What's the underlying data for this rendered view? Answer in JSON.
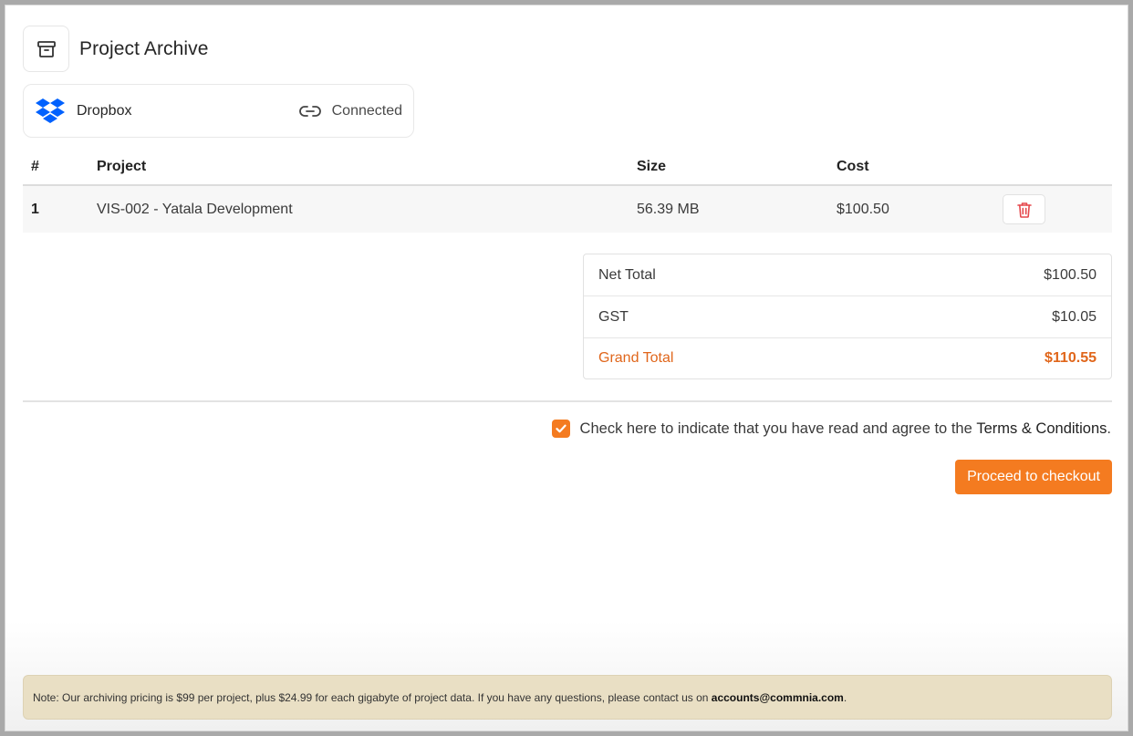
{
  "header": {
    "title": "Project Archive",
    "icon": "archive-box-icon"
  },
  "provider": {
    "name": "Dropbox",
    "status": "Connected",
    "icon": "dropbox-logo-icon",
    "status_icon": "link-icon"
  },
  "table": {
    "headers": {
      "num": "#",
      "project": "Project",
      "size": "Size",
      "cost": "Cost"
    },
    "rows": [
      {
        "num": "1",
        "project": "VIS-002 - Yatala Development",
        "size": "56.39 MB",
        "cost": "$100.50"
      }
    ]
  },
  "totals": {
    "net_label": "Net Total",
    "net_value": "$100.50",
    "gst_label": "GST",
    "gst_value": "$10.05",
    "grand_label": "Grand Total",
    "grand_value": "$110.55"
  },
  "terms": {
    "checked": true,
    "text": "Check here to indicate that you have read and agree to the ",
    "link": "Terms & Conditions",
    "suffix": "."
  },
  "checkout": {
    "label": "Proceed to checkout"
  },
  "note": {
    "text": "Note: Our archiving pricing is $99 per project, plus $24.99 for each gigabyte of project data. If you have any questions, please contact us on ",
    "email": "accounts@commnia.com",
    "suffix": "."
  },
  "colors": {
    "accent": "#f47b20",
    "grand_total": "#e0661b",
    "dropbox": "#0061fe",
    "delete": "#e5484d",
    "note_bg": "#e9dfc4"
  }
}
